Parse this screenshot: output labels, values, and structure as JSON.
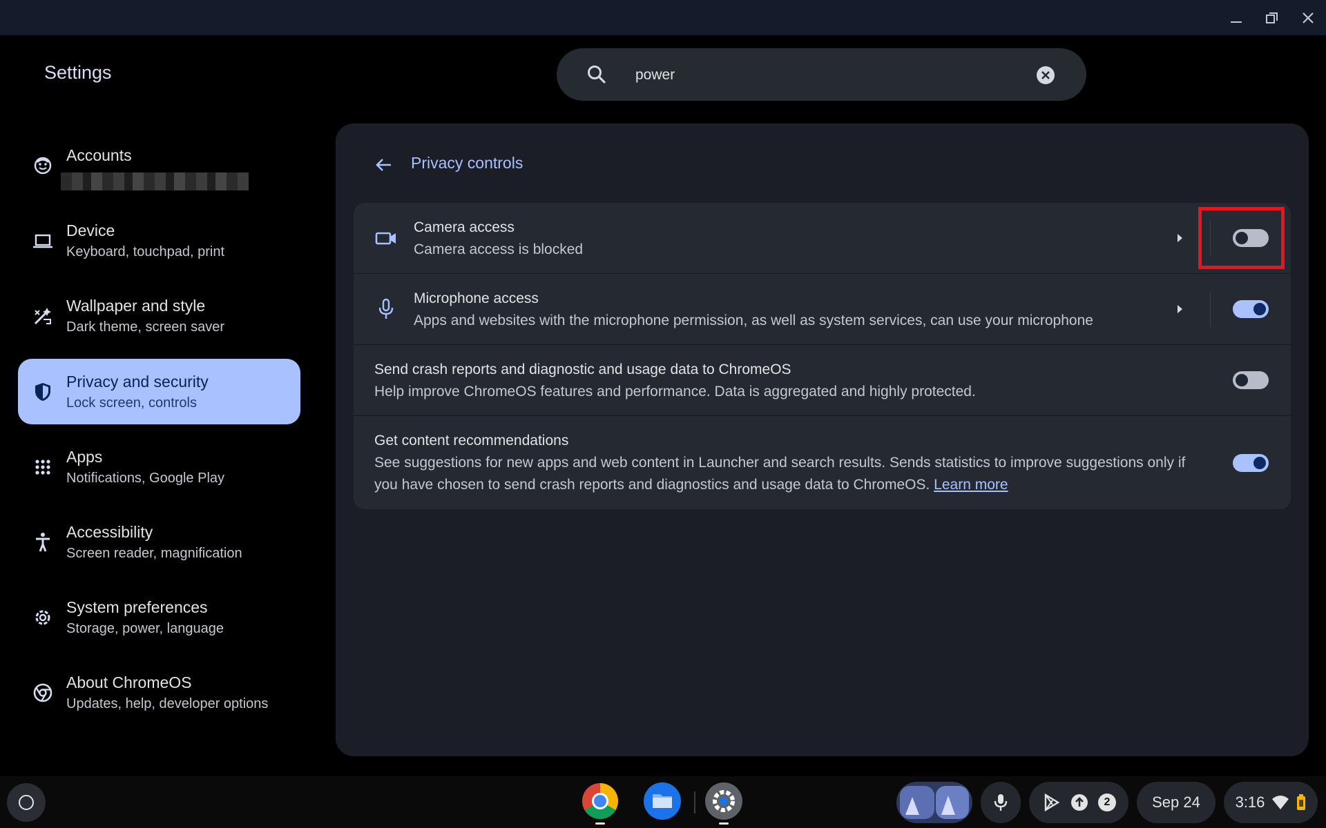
{
  "window": {
    "title": "Settings",
    "controls": [
      "minimize-icon",
      "restore-icon",
      "close-icon"
    ]
  },
  "search": {
    "value": "power",
    "icon": "search-icon",
    "clear_icon": "clear-icon"
  },
  "sidebar": {
    "items": [
      {
        "title": "Accounts",
        "subtitle": "",
        "icon": "account-icon",
        "active": false
      },
      {
        "title": "Device",
        "subtitle": "Keyboard, touchpad, print",
        "icon": "laptop-icon",
        "active": false
      },
      {
        "title": "Wallpaper and style",
        "subtitle": "Dark theme, screen saver",
        "icon": "paint-icon",
        "active": false
      },
      {
        "title": "Privacy and security",
        "subtitle": "Lock screen, controls",
        "icon": "shield-icon",
        "active": true
      },
      {
        "title": "Apps",
        "subtitle": "Notifications, Google Play",
        "icon": "apps-grid-icon",
        "active": false
      },
      {
        "title": "Accessibility",
        "subtitle": "Screen reader, magnification",
        "icon": "accessibility-icon",
        "active": false
      },
      {
        "title": "System preferences",
        "subtitle": "Storage, power, language",
        "icon": "gear-icon",
        "active": false
      },
      {
        "title": "About ChromeOS",
        "subtitle": "Updates, help, developer options",
        "icon": "chromeos-icon",
        "active": false
      }
    ]
  },
  "panel": {
    "title": "Privacy controls",
    "rows": [
      {
        "title": "Camera access",
        "subtitle": "Camera access is blocked",
        "icon": "camera-icon",
        "toggle_on": false
      },
      {
        "title": "Microphone access",
        "subtitle": "Apps and websites with the microphone permission, as well as system services, can use your microphone",
        "icon": "microphone-icon",
        "toggle_on": true
      },
      {
        "title": "Send crash reports and diagnostic and usage data to ChromeOS",
        "subtitle": "Help improve ChromeOS features and performance. Data is aggregated and highly protected.",
        "toggle_on": false
      },
      {
        "title": "Get content recommendations",
        "subtitle_line1": "See suggestions for new apps and web content in Launcher and search results. Sends statistics to improve suggestions only if",
        "subtitle_line2": "you have chosen to send crash reports and diagnostics and usage data to ChromeOS.",
        "link": "Learn more",
        "toggle_on": true
      }
    ]
  },
  "shelf": {
    "apps": [
      "chrome-icon",
      "files-icon",
      "settings-icon"
    ],
    "notification_count": "2",
    "date": "Sep 24",
    "time": "3:16"
  },
  "colors": {
    "accent": "#a9c1ff",
    "panel": "#1b1e26",
    "highlight": "#e8141e"
  }
}
